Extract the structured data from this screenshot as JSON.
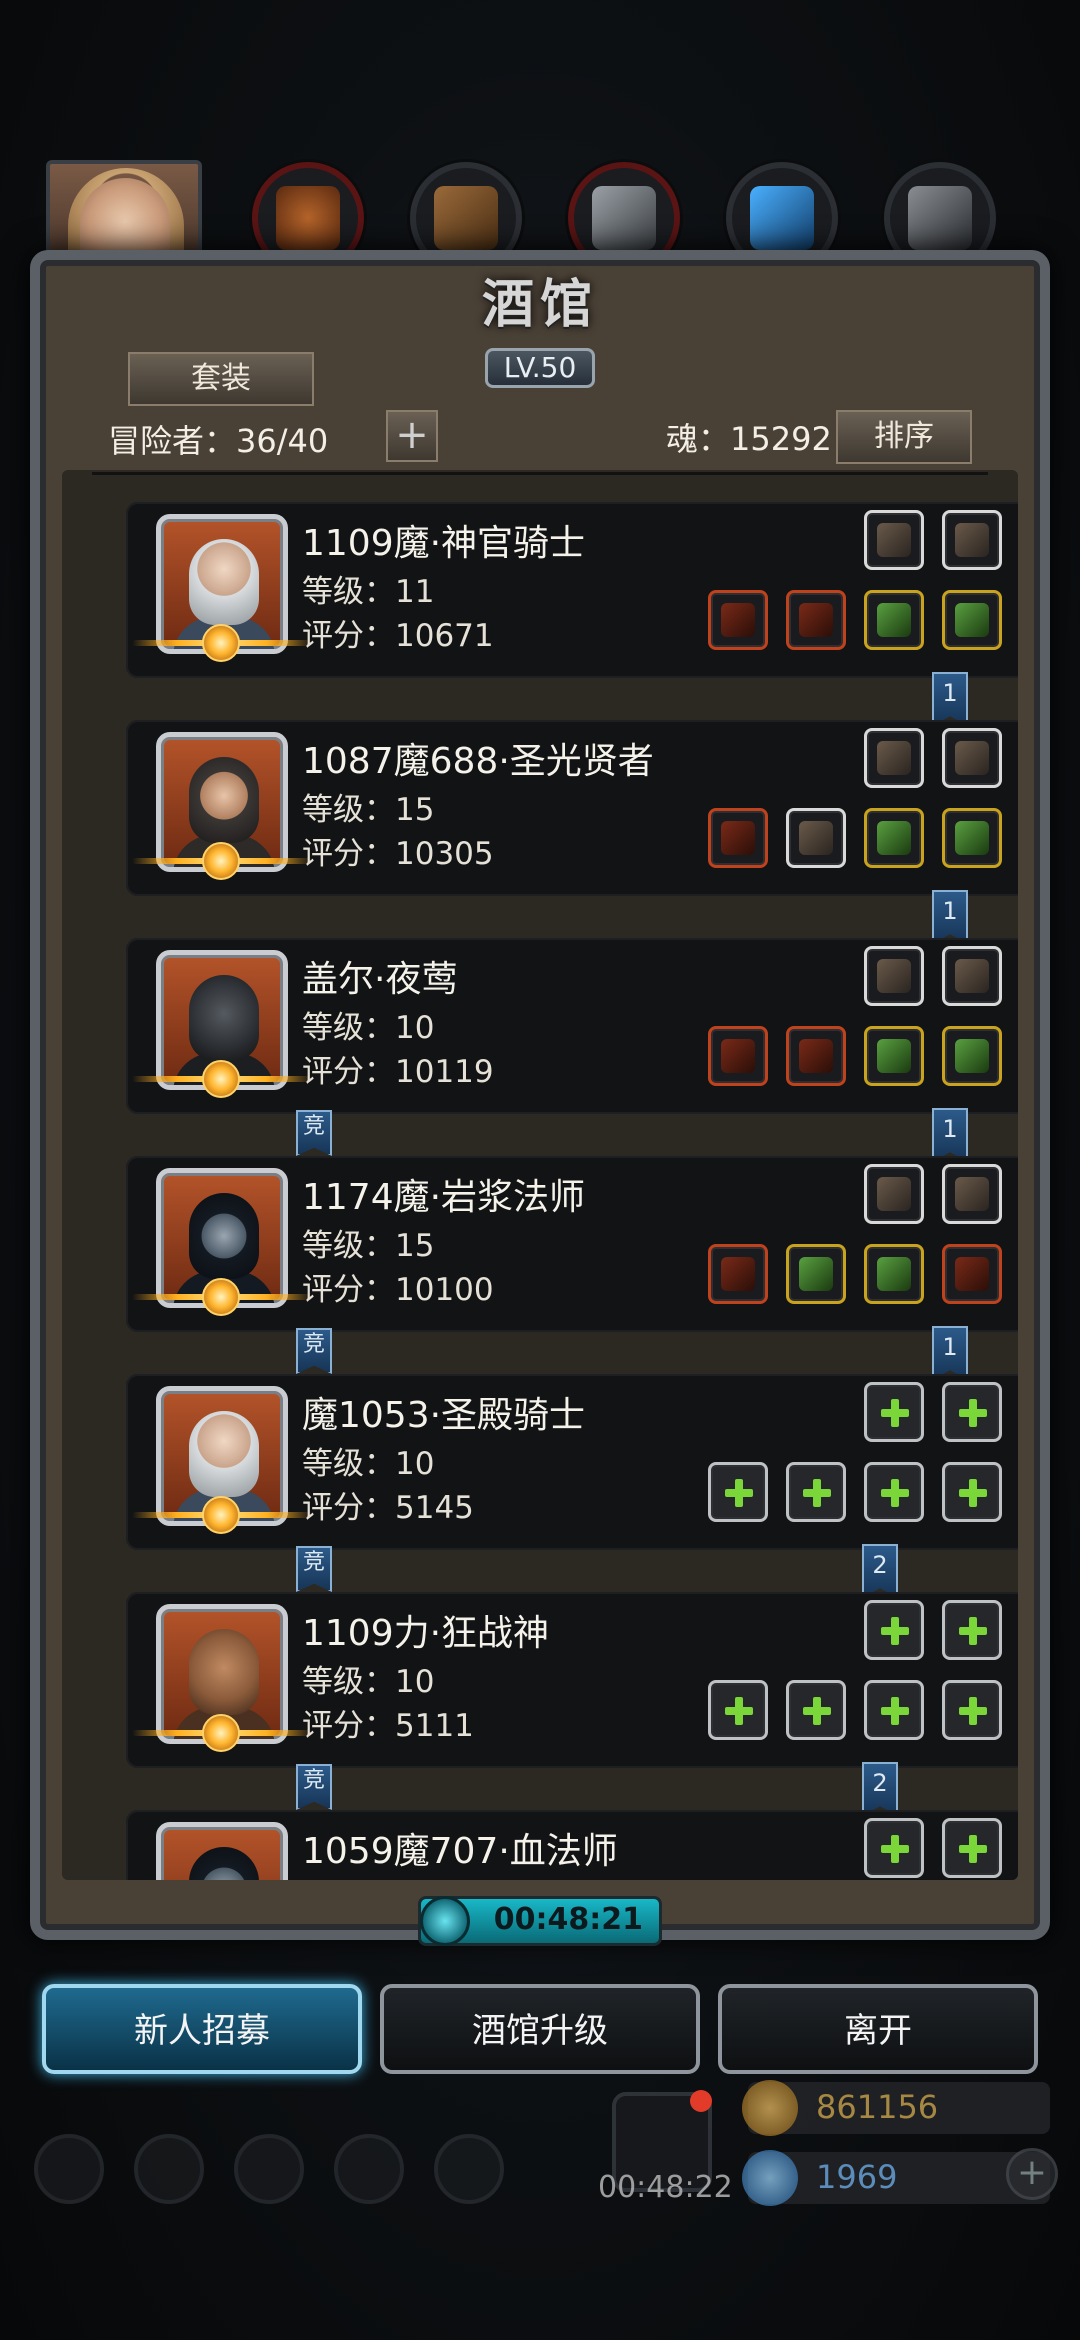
{
  "top_tabs": {
    "hero_tab": "hero-portrait",
    "categories": [
      "orb-helmet",
      "treasure-chest",
      "anvil",
      "blue-crystal",
      "forge"
    ]
  },
  "tavern": {
    "title": "酒馆",
    "level": "LV.50",
    "suit_button": "套装",
    "adventurers_label": "冒险者：36/40",
    "add_button": "+",
    "soul_label": "魂：15292",
    "sort_button": "排序"
  },
  "adventurers": [
    {
      "name": "1109魔·神官骑士",
      "level": "等级：11",
      "score": "评分：10671",
      "flag": "1",
      "jing": false,
      "top_slots": [
        "white",
        "white"
      ],
      "bottom_slots": [
        "red",
        "red",
        "gold",
        "gold"
      ],
      "portrait": "silver-hair-knight"
    },
    {
      "name": "1087魔688·圣光贤者",
      "level": "等级：15",
      "score": "评分：10305",
      "flag": "1",
      "jing": false,
      "top_slots": [
        "white",
        "white"
      ],
      "bottom_slots": [
        "red",
        "white",
        "gold",
        "gold"
      ],
      "portrait": "hooded-sage"
    },
    {
      "name": "盖尔·夜莺",
      "level": "等级：10",
      "score": "评分：10119",
      "flag": "1",
      "jing": "竞",
      "top_slots": [
        "white",
        "white"
      ],
      "bottom_slots": [
        "red",
        "red",
        "gold",
        "gold"
      ],
      "portrait": "masked-rogue"
    },
    {
      "name": "1174魔·岩浆法师",
      "level": "等级：15",
      "score": "评分：10100",
      "flag": "1",
      "jing": "竞",
      "top_slots": [
        "white",
        "white"
      ],
      "bottom_slots": [
        "red",
        "gold",
        "gold",
        "red"
      ],
      "portrait": "hooded-mage"
    },
    {
      "name": "魔1053·圣殿骑士",
      "level": "等级：10",
      "score": "评分：5145",
      "flag": "2",
      "jing": "竞",
      "top_slots": [
        "empty",
        "empty"
      ],
      "bottom_slots": [
        "empty",
        "empty",
        "empty",
        "empty"
      ],
      "portrait": "silver-hair-knight"
    },
    {
      "name": "1109力·狂战神",
      "level": "等级：10",
      "score": "评分：5111",
      "flag": "2",
      "jing": "竞",
      "top_slots": [
        "empty",
        "empty"
      ],
      "bottom_slots": [
        "empty",
        "empty",
        "empty",
        "empty"
      ],
      "portrait": "brute-warrior"
    },
    {
      "name": "1059魔707·血法师",
      "level": "",
      "score": "",
      "flag": "",
      "jing": false,
      "top_slots": [
        "empty",
        "empty"
      ],
      "bottom_slots": [],
      "portrait": "hooded-mage"
    }
  ],
  "timer": "00:48:21",
  "buttons": {
    "recruit": "新人招募",
    "upgrade": "酒馆升级",
    "leave": "离开"
  },
  "dock": {
    "timer": "00:48:22",
    "gold": "861156",
    "gems": "1969",
    "plus": "+"
  },
  "colors": {
    "slot_red": "#c0421c",
    "slot_gold": "#c9a21e",
    "slot_white": "#d9d9d9",
    "active_button": "#1f6a8f",
    "timer": "#18b8c8"
  }
}
